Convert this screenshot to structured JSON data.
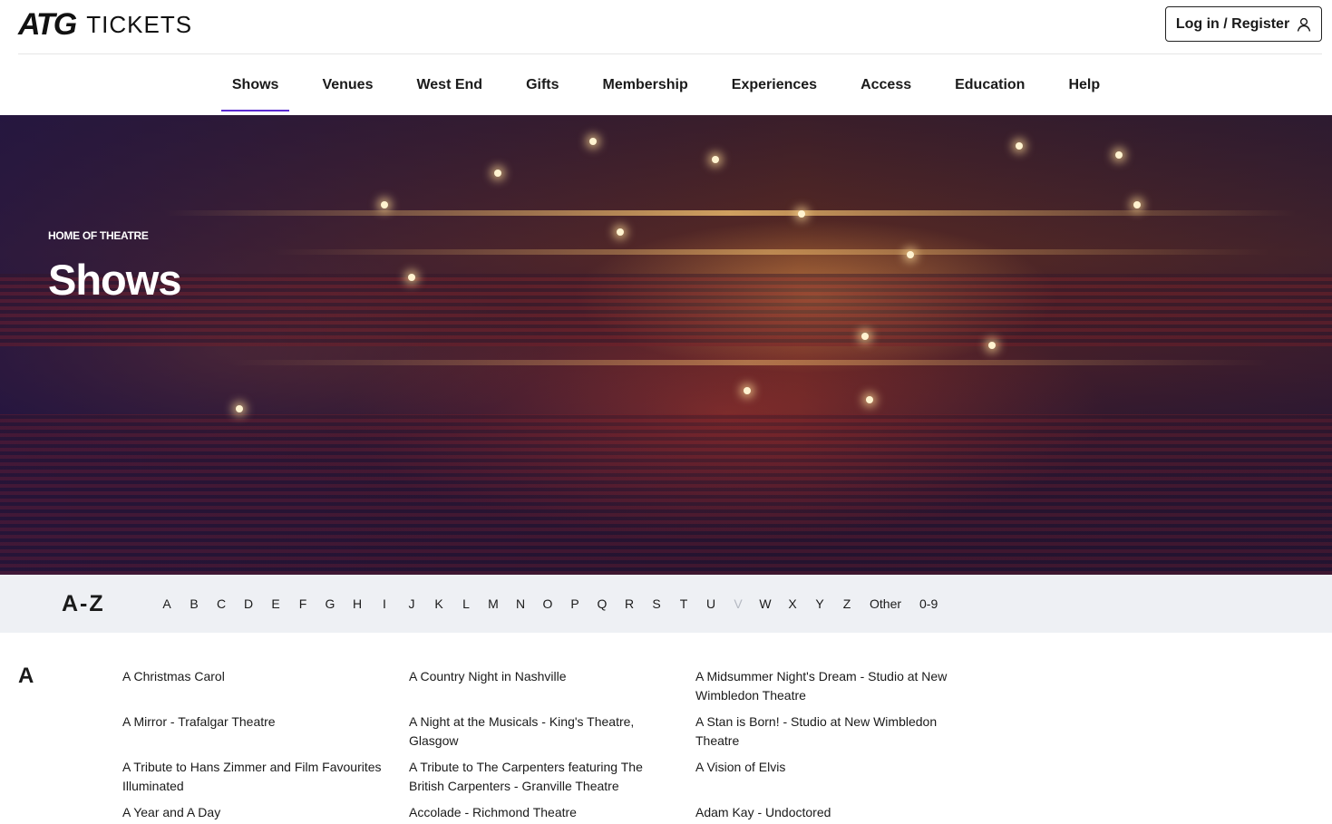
{
  "header": {
    "logo_mark": "ATG",
    "logo_text": "TICKETS",
    "login_label": "Log in / Register"
  },
  "nav": {
    "items": [
      {
        "label": "Shows",
        "active": true
      },
      {
        "label": "Venues"
      },
      {
        "label": "West End"
      },
      {
        "label": "Gifts"
      },
      {
        "label": "Membership"
      },
      {
        "label": "Experiences"
      },
      {
        "label": "Access"
      },
      {
        "label": "Education"
      },
      {
        "label": "Help"
      }
    ],
    "active_color": "#5b2bd1"
  },
  "hero": {
    "kicker": "HOME OF THEATRE",
    "title": "Shows"
  },
  "az": {
    "title": "A-Z",
    "letters": [
      "A",
      "B",
      "C",
      "D",
      "E",
      "F",
      "G",
      "H",
      "I",
      "J",
      "K",
      "L",
      "M",
      "N",
      "O",
      "P",
      "Q",
      "R",
      "S",
      "T",
      "U",
      "V",
      "W",
      "X",
      "Y",
      "Z",
      "Other",
      "0-9"
    ],
    "disabled": [
      "V"
    ]
  },
  "listing": {
    "section_letter": "A",
    "shows": [
      "A Christmas Carol",
      "A Country Night in Nashville",
      "A Midsummer Night's Dream - Studio at New Wimbledon Theatre",
      "A Mirror - Trafalgar Theatre",
      "A Night at the Musicals - King's Theatre, Glasgow",
      "A Stan is Born! - Studio at New Wimbledon Theatre",
      "A Tribute to Hans Zimmer and Film Favourites Illuminated",
      "A Tribute to The Carpenters featuring The British Carpenters - Granville Theatre",
      "A Vision of Elvis",
      "A Year and A Day",
      "Accolade - Richmond Theatre",
      "Adam Kay - Undoctored"
    ]
  }
}
